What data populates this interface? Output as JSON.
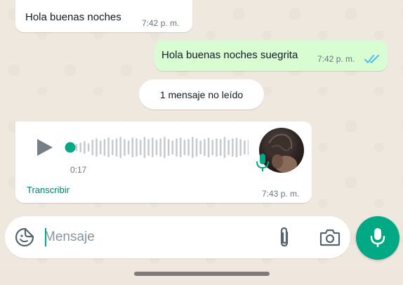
{
  "messages": [
    {
      "direction": "incoming",
      "text": "Hola buenas noches",
      "time": "7:42 p. m."
    },
    {
      "direction": "outgoing",
      "text": "Hola buenas noches suegrita",
      "time": "7:42 p. m.",
      "status": "read"
    }
  ],
  "unread_banner": "1 mensaje no leído",
  "voice_note": {
    "duration": "0:17",
    "progress": 0,
    "transcribe_label": "Transcribir",
    "time": "7:43 p. m."
  },
  "composer": {
    "placeholder": "Mensaje",
    "value": ""
  },
  "icons": {
    "play": "play-icon",
    "mic_badge": "mic-icon",
    "emoji": "sticker-icon",
    "attach": "paperclip-icon",
    "camera": "camera-icon",
    "send_voice": "mic-icon",
    "read_receipt": "double-check-icon"
  },
  "colors": {
    "outgoing_bubble": "#d9fdd3",
    "incoming_bubble": "#ffffff",
    "accent": "#00a884",
    "read_ticks": "#53bdeb",
    "chat_background": "#efe8de"
  }
}
